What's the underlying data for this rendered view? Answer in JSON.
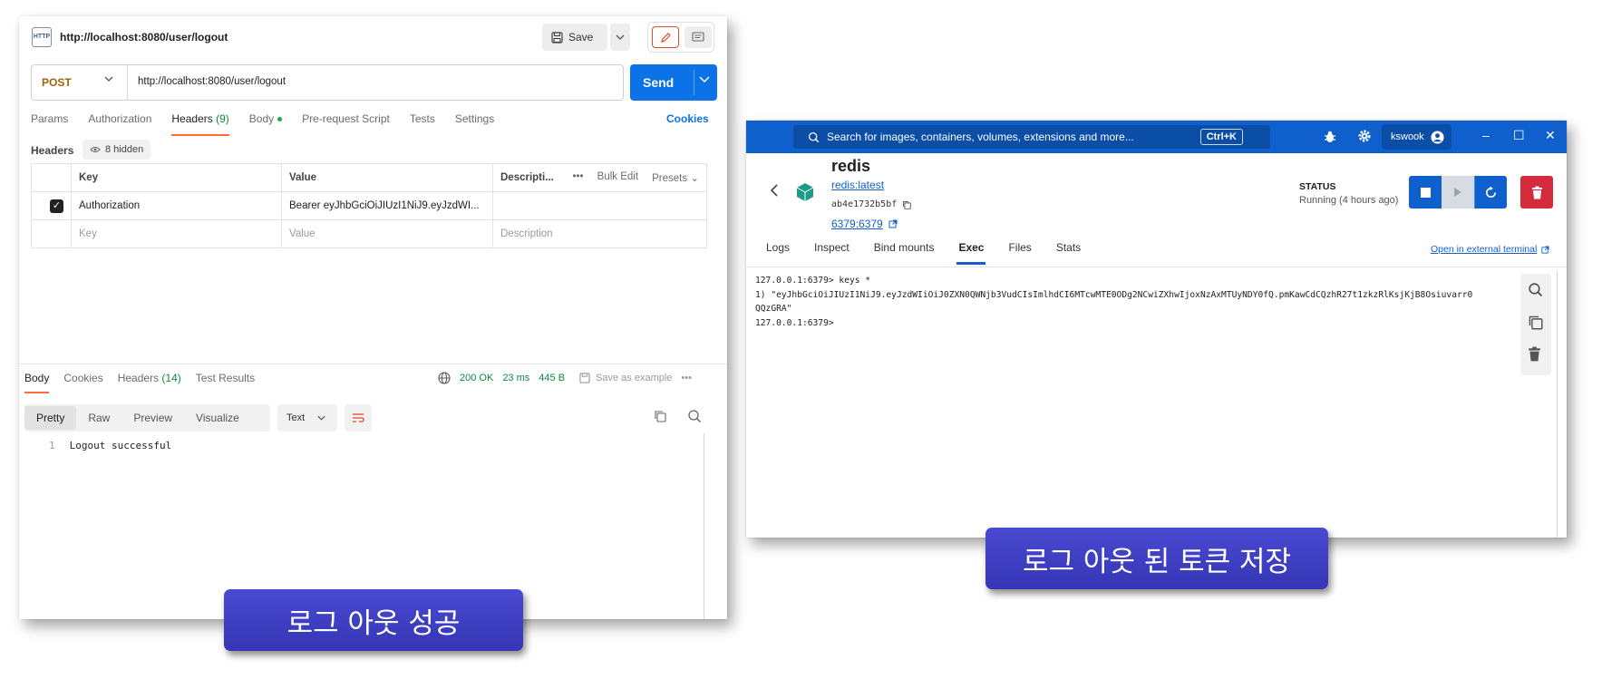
{
  "postman": {
    "tab_title": "http://localhost:8080/user/logout",
    "http_icon_label": "HTTP",
    "save_label": "Save",
    "method": "POST",
    "url": "http://localhost:8080/user/logout",
    "send_label": "Send",
    "request_tabs": [
      {
        "label": "Params"
      },
      {
        "label": "Authorization"
      },
      {
        "label": "Headers",
        "count": "(9)"
      },
      {
        "label": "Body"
      },
      {
        "label": "Pre-request Script"
      },
      {
        "label": "Tests"
      },
      {
        "label": "Settings"
      }
    ],
    "cookies_label": "Cookies",
    "headers_label": "Headers",
    "hidden_label": "8 hidden",
    "table": {
      "col_key": "Key",
      "col_value": "Value",
      "col_desc": "Descripti...",
      "more": "•••",
      "bulk_edit": "Bulk Edit",
      "presets": "Presets",
      "row": {
        "key": "Authorization",
        "value": "Bearer eyJhbGciOiJIUzI1NiJ9.eyJzdWI...",
        "description": ""
      },
      "placeholder": {
        "key": "Key",
        "value": "Value",
        "description": "Description"
      }
    },
    "response_tabs": [
      {
        "label": "Body"
      },
      {
        "label": "Cookies"
      },
      {
        "label": "Headers",
        "count": "(14)"
      },
      {
        "label": "Test Results"
      }
    ],
    "status": {
      "code": "200 OK",
      "time": "23 ms",
      "size": "445 B",
      "save_example": "Save as example",
      "more": "•••"
    },
    "formats": [
      "Pretty",
      "Raw",
      "Preview",
      "Visualize"
    ],
    "type_select": "Text",
    "code": {
      "line_no": "1",
      "text": "Logout successful"
    }
  },
  "docker": {
    "search_placeholder": "Search for images, containers, volumes, extensions and more...",
    "shortcut": "Ctrl+K",
    "username": "kswook",
    "container_name": "redis",
    "image": "redis:latest",
    "container_id": "ab4e1732b5bf",
    "port": "6379:6379",
    "status_label": "STATUS",
    "status_value": "Running (4 hours ago)",
    "tabs": [
      "Logs",
      "Inspect",
      "Bind mounts",
      "Exec",
      "Files",
      "Stats"
    ],
    "external_terminal": "Open in external terminal",
    "terminal_lines": [
      "127.0.0.1:6379> keys *",
      "1) \"eyJhbGciOiJIUzI1NiJ9.eyJzdWIiOiJ0ZXN0QWNjb3VudCIsImlhdCI6MTcwMTE0ODg2NCwiZXhwIjoxNzAxMTUyNDY0fQ.pmKawCdCQzhR27t1zkzRlKsjKjB8Osiuvarr0",
      "QQzGRA\"",
      "127.0.0.1:6379>"
    ]
  },
  "captions": {
    "left": "로그 아웃 성공",
    "right": "로그 아웃 된 토큰 저장"
  },
  "colors": {
    "postman_send": "#0b72e8",
    "postman_accent": "#ff6c37",
    "docker_blue": "#0f60cc",
    "docker_delete": "#d42c3c",
    "caption_bg": "#3f3fc4"
  }
}
